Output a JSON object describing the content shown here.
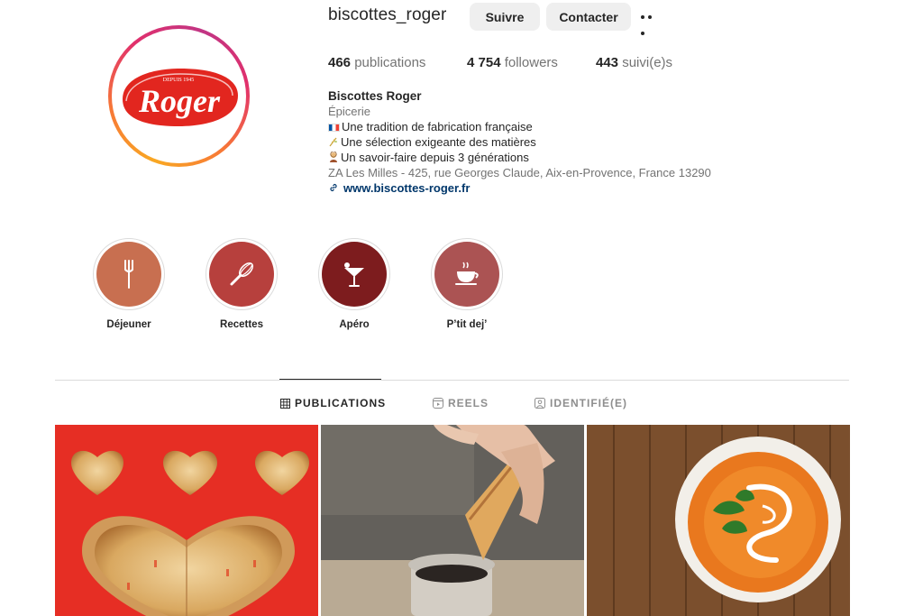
{
  "profile": {
    "username": "biscottes_roger",
    "follow_label": "Suivre",
    "contact_label": "Contacter",
    "more_icon": "more-horizontal-icon",
    "logo_text": "Roger",
    "logo_tagline": "Depuis 1945"
  },
  "stats": {
    "posts_count": "466",
    "posts_label": "publications",
    "followers_count": "4 754",
    "followers_label": "followers",
    "following_count": "443",
    "following_label": "suivi(e)s"
  },
  "bio": {
    "name": "Biscottes Roger",
    "category": "Épicerie",
    "line1": "Une tradition de fabrication française",
    "line2": "Une sélection exigeante des matières",
    "line3": "Un savoir-faire depuis 3 générations",
    "address": "ZA Les Milles - 425, rue Georges Claude, Aix-en-Provence, France 13290",
    "website": "www.biscottes-roger.fr"
  },
  "highlights": [
    {
      "label": "Déjeuner",
      "icon": "fork-icon",
      "color": "#c86f50"
    },
    {
      "label": "Recettes",
      "icon": "whisk-icon",
      "color": "#b7403d"
    },
    {
      "label": "Apéro",
      "icon": "cocktail-icon",
      "color": "#7d1c1e"
    },
    {
      "label": "P’tit dej’",
      "icon": "coffee-cup-icon",
      "color": "#ab5353"
    }
  ],
  "tabs": [
    {
      "label": "PUBLICATIONS",
      "icon": "grid-icon",
      "active": true
    },
    {
      "label": "REELS",
      "icon": "reels-icon",
      "active": false
    },
    {
      "label": "IDENTIFIÉ(E)",
      "icon": "tagged-icon",
      "active": false
    }
  ],
  "colors": {
    "brand_red": "#e2261f",
    "link": "#00376b",
    "muted": "#737373"
  }
}
